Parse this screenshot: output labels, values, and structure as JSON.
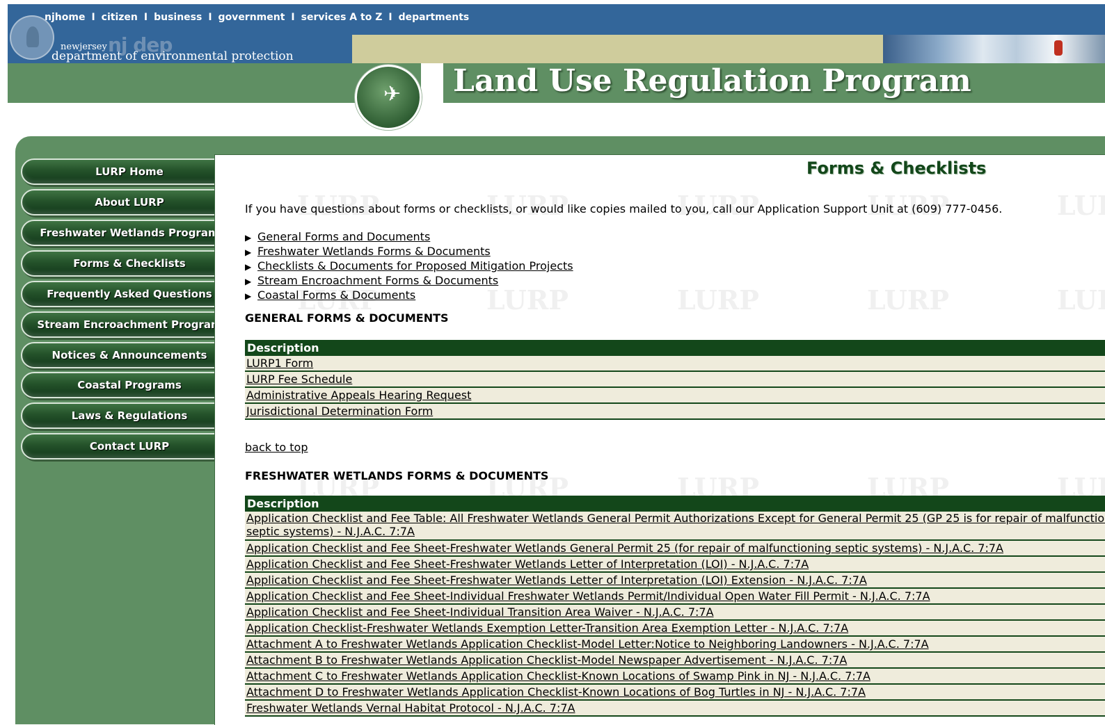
{
  "topnav": [
    "njhome",
    "citizen",
    "business",
    "government",
    "services A to Z",
    "departments"
  ],
  "topnav_separator": "I",
  "header": {
    "dep_small": "newjersey",
    "dep_njdep": "nj dep",
    "dep_full": "department of environmental protection",
    "program_title": "Land Use Regulation Program"
  },
  "sidebar": [
    "LURP Home",
    "About LURP",
    "Freshwater Wetlands Program",
    "Forms & Checklists",
    "Frequently Asked Questions",
    "Stream Encroachment Program",
    "Notices & Announcements",
    "Coastal Programs",
    "Laws & Regulations",
    "Contact LURP"
  ],
  "watermark": "LURP",
  "main": {
    "title": "Forms & Checklists",
    "intro": "If you have questions about forms or checklists, or would like copies mailed to you, call our Application Support Unit at (609) 777-0456.",
    "anchors": [
      "General Forms and Documents",
      "Freshwater Wetlands Forms & Documents",
      "Checklists & Documents for Proposed Mitigation Projects",
      "Stream Encroachment Forms & Documents",
      "Coastal Forms & Documents"
    ],
    "general": {
      "heading": "GENERAL FORMS & DOCUMENTS",
      "column": "Description",
      "rows": [
        "LURP1 Form",
        "LURP Fee Schedule",
        "Administrative Appeals Hearing Request",
        "Jurisdictional Determination Form"
      ]
    },
    "back_to_top": "back to top",
    "freshwater": {
      "heading": "FRESHWATER WETLANDS FORMS & DOCUMENTS",
      "column": "Description",
      "rows": [
        "Application Checklist and Fee Table: All Freshwater Wetlands General Permit Authorizations Except for General Permit 25 (GP 25 is for repair of malfunctioning",
        "septic systems) - N.J.A.C. 7:7A",
        "Application Checklist and Fee Sheet-Freshwater Wetlands General Permit 25 (for repair of malfunctioning septic systems) - N.J.A.C. 7:7A",
        "Application Checklist and Fee Sheet-Freshwater Wetlands Letter of Interpretation (LOI) - N.J.A.C. 7:7A",
        "Application Checklist and Fee Sheet-Freshwater Wetlands Letter of Interpretation (LOI) Extension - N.J.A.C. 7:7A",
        "Application Checklist and Fee Sheet-Individual Freshwater Wetlands Permit/Individual Open Water Fill Permit - N.J.A.C. 7:7A",
        "Application Checklist and Fee Sheet-Individual Transition Area Waiver - N.J.A.C. 7:7A",
        "Application Checklist-Freshwater Wetlands Exemption Letter-Transition Area Exemption Letter - N.J.A.C. 7:7A",
        "Attachment A to Freshwater Wetlands Application Checklist-Model Letter:Notice to Neighboring Landowners - N.J.A.C. 7:7A",
        "Attachment B to Freshwater Wetlands Application Checklist-Model Newspaper Advertisement - N.J.A.C. 7:7A",
        "Attachment C to Freshwater Wetlands Application Checklist-Known Locations of Swamp Pink in NJ - N.J.A.C. 7:7A",
        "Attachment D to Freshwater Wetlands Application Checklist-Known Locations of Bog Turtles in NJ - N.J.A.C. 7:7A",
        "Freshwater Wetlands Vernal Habitat Protocol - N.J.A.C. 7:7A"
      ]
    }
  }
}
